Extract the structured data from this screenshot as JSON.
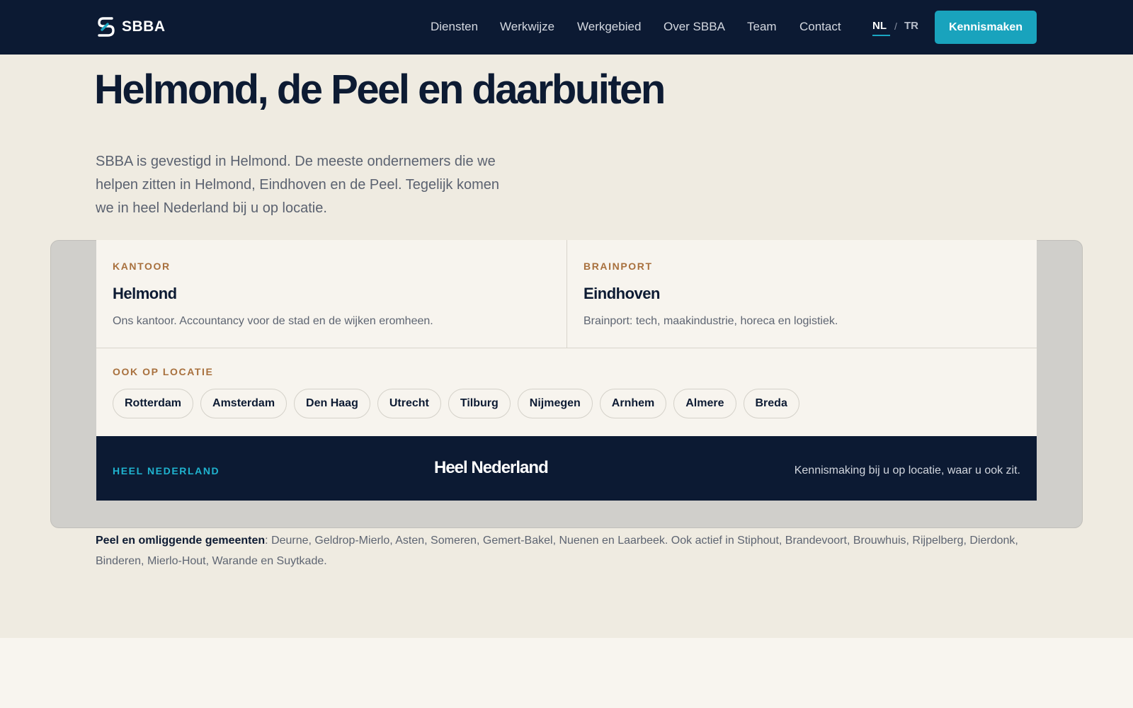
{
  "brand": {
    "logo_text": "SBBA"
  },
  "nav": {
    "items": [
      "Diensten",
      "Werkwijze",
      "Werkgebied",
      "Over SBBA",
      "Team",
      "Contact"
    ],
    "lang_nl": "NL",
    "lang_sep": "/",
    "lang_tr": "TR",
    "cta": "Kennismaken"
  },
  "hero": {
    "title": "Helmond, de Peel en daarbuiten",
    "intro": "SBBA is gevestigd in Helmond. De meeste ondernemers die we helpen zitten in Helmond, Eindhoven en de Peel. Tegelijk komen we in heel Nederland bij u op locatie."
  },
  "locations": {
    "office": {
      "eyebrow": "KANTOOR",
      "city": "Helmond",
      "desc": "Ons kantoor. Accountancy voor de stad en de wijken eromheen."
    },
    "brainport": {
      "eyebrow": "BRAINPORT",
      "city": "Eindhoven",
      "desc": "Brainport: tech, maakindustrie, horeca en logistiek."
    },
    "onsite": {
      "eyebrow": "OOK OP LOCATIE",
      "cities": [
        "Rotterdam",
        "Amsterdam",
        "Den Haag",
        "Utrecht",
        "Tilburg",
        "Nijmegen",
        "Arnhem",
        "Almere",
        "Breda"
      ]
    },
    "nationwide": {
      "eyebrow": "HEEL NEDERLAND",
      "title": "Heel Nederland",
      "text": "Kennismaking bij u op locatie, waar u ook zit."
    }
  },
  "footnote": {
    "lead": "Peel en omliggende gemeenten",
    "text": ": Deurne, Geldrop-Mierlo, Asten, Someren, Gemert-Bakel, Nuenen en Laarbeek. Ook actief in Stiphout, Brandevoort, Brouwhuis, Rijpelberg, Dierdonk, Binderen, Mierlo-Hout, Warande en Suytkade."
  },
  "colors": {
    "navy": "#0c1a33",
    "accent": "#19a3bd",
    "eyebrow": "#a8703d",
    "beige": "#efebe1"
  }
}
